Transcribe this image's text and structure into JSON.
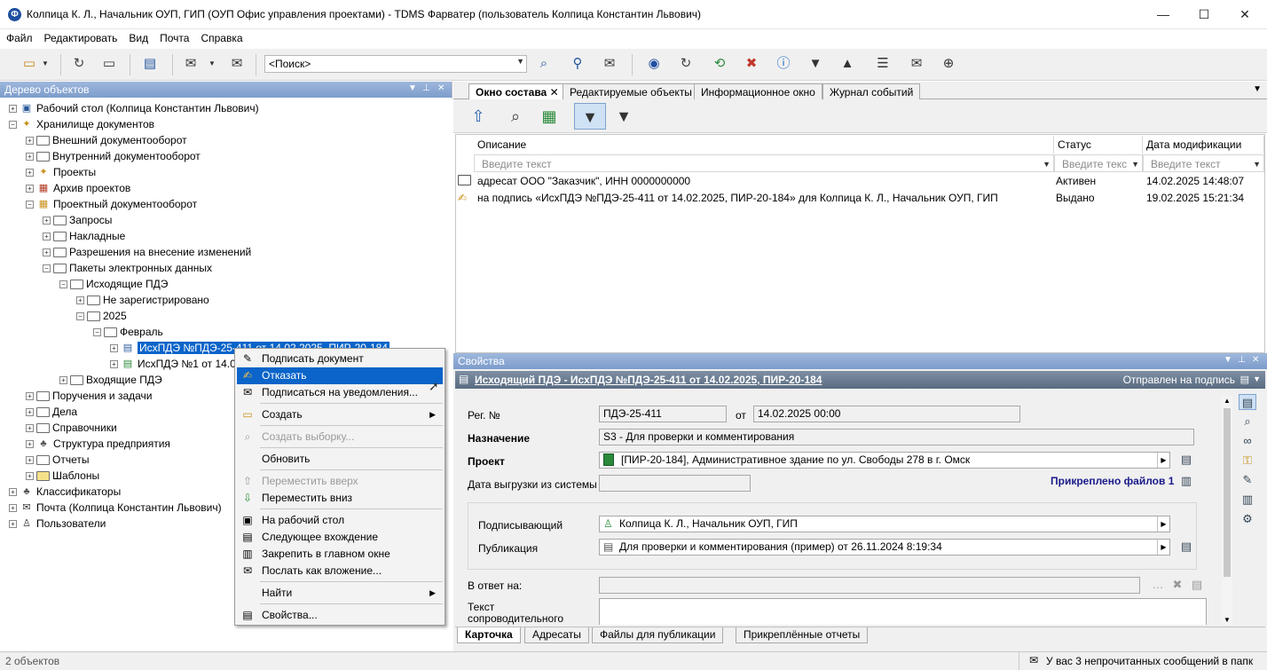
{
  "window": {
    "title": "Колпица К. Л., Начальник ОУП, ГИП (ОУП Офис управления проектами) - TDMS Фарватер (пользователь Колпица Константин Львович)",
    "minimize": "—",
    "maximize": "☐",
    "close": "✕"
  },
  "menu": [
    "Файл",
    "Редактировать",
    "Вид",
    "Почта",
    "Справка"
  ],
  "toolbar": {
    "search_value": "<Поиск>"
  },
  "tree": {
    "title": "Дерево объектов",
    "nodes": [
      {
        "label": "Рабочий стол (Колпица Константин Львович)"
      },
      {
        "label": "Хранилище документов"
      },
      {
        "label": "Внешний документооборот"
      },
      {
        "label": "Внутренний документооборот"
      },
      {
        "label": "Проекты"
      },
      {
        "label": "Архив проектов"
      },
      {
        "label": "Проектный документооборот"
      },
      {
        "label": "Запросы"
      },
      {
        "label": "Накладные"
      },
      {
        "label": "Разрешения на внесение изменений"
      },
      {
        "label": "Пакеты электронных данных"
      },
      {
        "label": "Исходящие ПДЭ"
      },
      {
        "label": "Не зарегистрировано"
      },
      {
        "label": "2025"
      },
      {
        "label": "Февраль"
      },
      {
        "label": "ИсхПДЭ №ПДЭ-25-411 от 14.02.2025, ПИР-20-184"
      },
      {
        "label": "ИсхПДЭ №1 от 14.0"
      },
      {
        "label": "Входящие ПДЭ"
      },
      {
        "label": "Поручения и задачи"
      },
      {
        "label": "Дела"
      },
      {
        "label": "Справочники"
      },
      {
        "label": "Структура предприятия"
      },
      {
        "label": "Отчеты"
      },
      {
        "label": "Шаблоны"
      },
      {
        "label": "Классификаторы"
      },
      {
        "label": "Почта (Колпица Константин Львович)"
      },
      {
        "label": "Пользователи"
      }
    ]
  },
  "context_menu": {
    "items": [
      {
        "label": "Подписать документ"
      },
      {
        "label": "Отказать"
      },
      {
        "label": "Подписаться на уведомления..."
      },
      {
        "label": "Создать"
      },
      {
        "label": "Создать выборку..."
      },
      {
        "label": "Обновить"
      },
      {
        "label": "Переместить вверх"
      },
      {
        "label": "Переместить вниз"
      },
      {
        "label": "На рабочий стол"
      },
      {
        "label": "Следующее вхождение"
      },
      {
        "label": "Закрепить в главном окне"
      },
      {
        "label": "Послать как вложение..."
      },
      {
        "label": "Найти"
      },
      {
        "label": "Свойства..."
      }
    ]
  },
  "main_tabs": [
    "Окно состава",
    "Редактируемые объекты",
    "Информационное окно",
    "Журнал событий"
  ],
  "grid": {
    "columns": [
      "Описание",
      "Статус",
      "Дата модификации"
    ],
    "filter_placeholder": [
      "Введите текст",
      "Введите текс",
      "Введите текст"
    ],
    "rows": [
      {
        "desc": "адресат ООО \"Заказчик\", ИНН 0000000000",
        "status": "Активен",
        "date": "14.02.2025 14:48:07"
      },
      {
        "desc": "на подпись «ИсхПДЭ №ПДЭ-25-411 от 14.02.2025, ПИР-20-184» для Колпица К. Л., Начальник ОУП, ГИП",
        "status": "Выдано",
        "date": "19.02.2025 15:21:34"
      }
    ]
  },
  "props": {
    "title": "Свойства",
    "header": "Исходящий ПДЭ - ИсхПДЭ №ПДЭ-25-411 от 14.02.2025, ПИР-20-184",
    "state": "Отправлен на подпись",
    "reg_label": "Рег. №",
    "reg_value": "ПДЭ-25-411",
    "from_label": "от",
    "date_value": "14.02.2025 00:00",
    "purpose_label": "Назначение",
    "purpose_value": "S3 - Для проверки и комментирования",
    "project_label": "Проект",
    "project_value": "[ПИР-20-184], Административное здание по ул. Свободы 278 в г. Омск",
    "export_label": "Дата выгрузки из системы",
    "attached": "Прикреплено файлов 1",
    "signer_label": "Подписывающий",
    "signer_value": "Колпица К. Л., Начальник ОУП, ГИП",
    "pub_label": "Публикация",
    "pub_value": "Для проверки и комментирования (пример) от 26.11.2024 8:19:34",
    "reply_label": "В ответ на:",
    "letter_label": "Текст сопроводительного письма",
    "tabs": [
      "Карточка",
      "Адресаты",
      "Файлы для публикации",
      "Прикреплённые отчеты"
    ]
  },
  "status": {
    "left": "2 объектов",
    "right": "У вас 3 непрочитанных сообщений в папк"
  }
}
